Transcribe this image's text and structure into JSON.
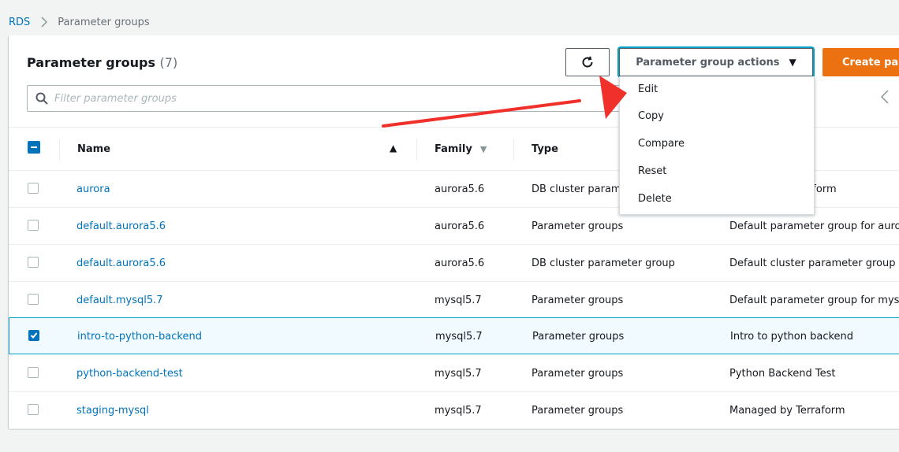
{
  "breadcrumb": {
    "root": "RDS",
    "current": "Parameter groups"
  },
  "panel": {
    "title": "Parameter groups",
    "count": "(7)"
  },
  "toolbar": {
    "actions_label": "Parameter group actions",
    "create_label": "Create par"
  },
  "filter": {
    "placeholder": "Filter parameter groups"
  },
  "columns": {
    "name": "Name",
    "family": "Family",
    "type": "Type"
  },
  "menu": {
    "items": [
      "Edit",
      "Copy",
      "Compare",
      "Reset",
      "Delete"
    ]
  },
  "rows": [
    {
      "name": "aurora",
      "family": "aurora5.6",
      "type": "DB cluster param",
      "description": "raform",
      "checked": false
    },
    {
      "name": "default.aurora5.6",
      "family": "aurora5.6",
      "type": "Parameter groups",
      "description": "Default parameter group for auro",
      "checked": false
    },
    {
      "name": "default.aurora5.6",
      "family": "aurora5.6",
      "type": "DB cluster parameter group",
      "description": "Default cluster parameter group",
      "checked": false
    },
    {
      "name": "default.mysql5.7",
      "family": "mysql5.7",
      "type": "Parameter groups",
      "description": "Default parameter group for mys",
      "checked": false
    },
    {
      "name": "intro-to-python-backend",
      "family": "mysql5.7",
      "type": "Parameter groups",
      "description": "Intro to python backend",
      "checked": true
    },
    {
      "name": "python-backend-test",
      "family": "mysql5.7",
      "type": "Parameter groups",
      "description": "Python Backend Test",
      "checked": false
    },
    {
      "name": "staging-mysql",
      "family": "mysql5.7",
      "type": "Parameter groups",
      "description": "Managed by Terraform",
      "checked": false
    }
  ],
  "colors": {
    "link": "#0073bb",
    "primary": "#ec7211",
    "focus": "#00a1c9",
    "annotation": "#f0302a"
  }
}
